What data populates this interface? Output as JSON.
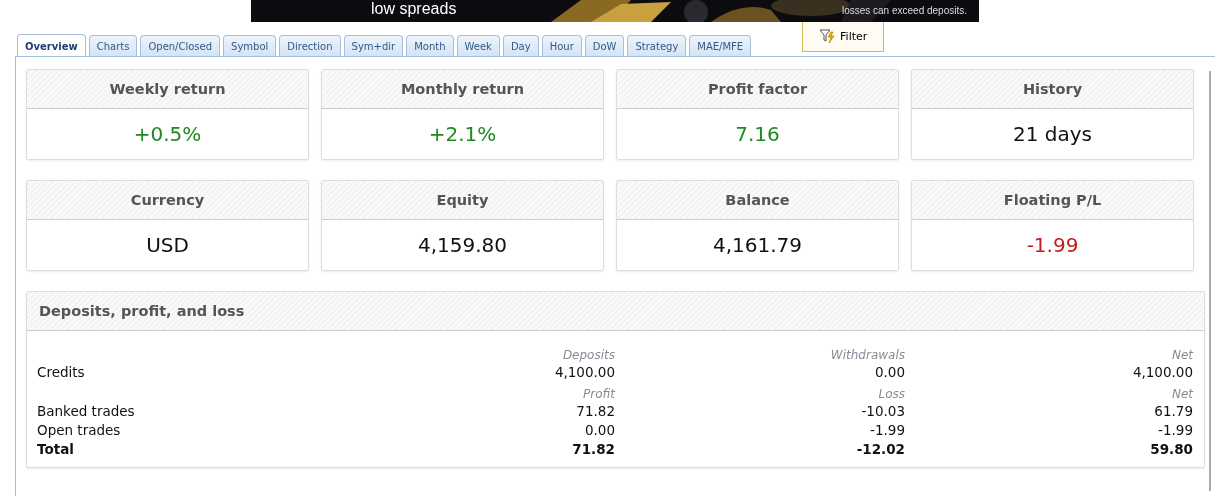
{
  "banner": {
    "headline": "low spreads",
    "disclaimer": "losses can exceed deposits."
  },
  "tabs": [
    {
      "label": "Overview",
      "selected": true
    },
    {
      "label": "Charts",
      "selected": false
    },
    {
      "label": "Open/Closed",
      "selected": false
    },
    {
      "label": "Symbol",
      "selected": false
    },
    {
      "label": "Direction",
      "selected": false
    },
    {
      "label": "Sym+dir",
      "selected": false
    },
    {
      "label": "Month",
      "selected": false
    },
    {
      "label": "Week",
      "selected": false
    },
    {
      "label": "Day",
      "selected": false
    },
    {
      "label": "Hour",
      "selected": false
    },
    {
      "label": "DoW",
      "selected": false
    },
    {
      "label": "Strategy",
      "selected": false
    },
    {
      "label": "MAE/MFE",
      "selected": false
    }
  ],
  "filter_button": {
    "label": "Filter"
  },
  "stat_cards": [
    {
      "title": "Weekly return",
      "value": "+0.5%",
      "color": "#1f8a1f"
    },
    {
      "title": "Monthly return",
      "value": "+2.1%",
      "color": "#1f8a1f"
    },
    {
      "title": "Profit factor",
      "value": "7.16",
      "color": "#1f8a1f"
    },
    {
      "title": "History",
      "value": "21 days",
      "color": "#111111"
    },
    {
      "title": "Currency",
      "value": "USD",
      "color": "#111111"
    },
    {
      "title": "Equity",
      "value": "4,159.80",
      "color": "#111111"
    },
    {
      "title": "Balance",
      "value": "4,161.79",
      "color": "#111111"
    },
    {
      "title": "Floating P/L",
      "value": "-1.99",
      "color": "#c41b1b"
    }
  ],
  "summary": {
    "title": "Deposits, profit, and loss",
    "groups": [
      {
        "headers": [
          "Deposits",
          "Withdrawals",
          "Net"
        ],
        "rows": [
          {
            "label": "Credits",
            "values": [
              "4,100.00",
              "0.00",
              "4,100.00"
            ],
            "total": false
          }
        ]
      },
      {
        "headers": [
          "Profit",
          "Loss",
          "Net"
        ],
        "rows": [
          {
            "label": "Banked trades",
            "values": [
              "71.82",
              "-10.03",
              "61.79"
            ],
            "total": false
          },
          {
            "label": "Open trades",
            "values": [
              "0.00",
              "-1.99",
              "-1.99"
            ],
            "total": false
          },
          {
            "label": "Total",
            "values": [
              "71.82",
              "-12.02",
              "59.80"
            ],
            "total": true
          }
        ]
      }
    ]
  }
}
